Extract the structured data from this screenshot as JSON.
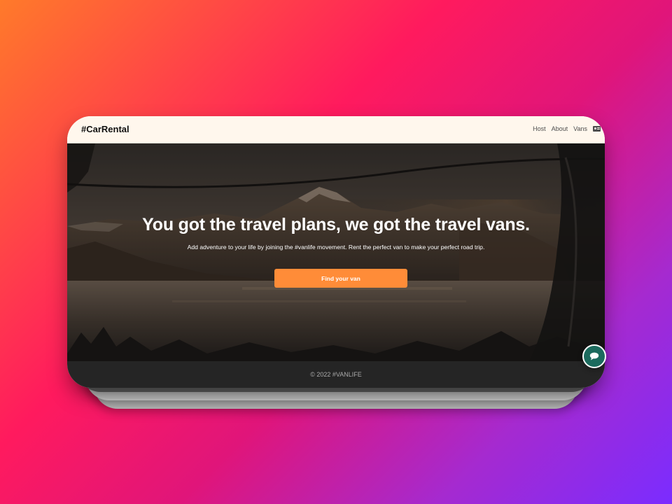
{
  "navbar": {
    "brand": "#CarRental",
    "links": [
      "Host",
      "About",
      "Vans"
    ],
    "login_icon": "id-card-icon"
  },
  "hero": {
    "title": "You got the travel plans, we got the travel vans.",
    "subtitle": "Add adventure to your life by joining the #vanlife movement. Rent the perfect van to make your perfect road trip.",
    "cta_label": "Find your van"
  },
  "footer": {
    "text": "© 2022 #VANLIFE"
  },
  "chat_icon": "chat-bubble-icon",
  "colors": {
    "accent": "#ff8c38",
    "nav_background": "#fff7ed",
    "footer_background": "#252525",
    "chat_button": "#1c6b5e"
  }
}
